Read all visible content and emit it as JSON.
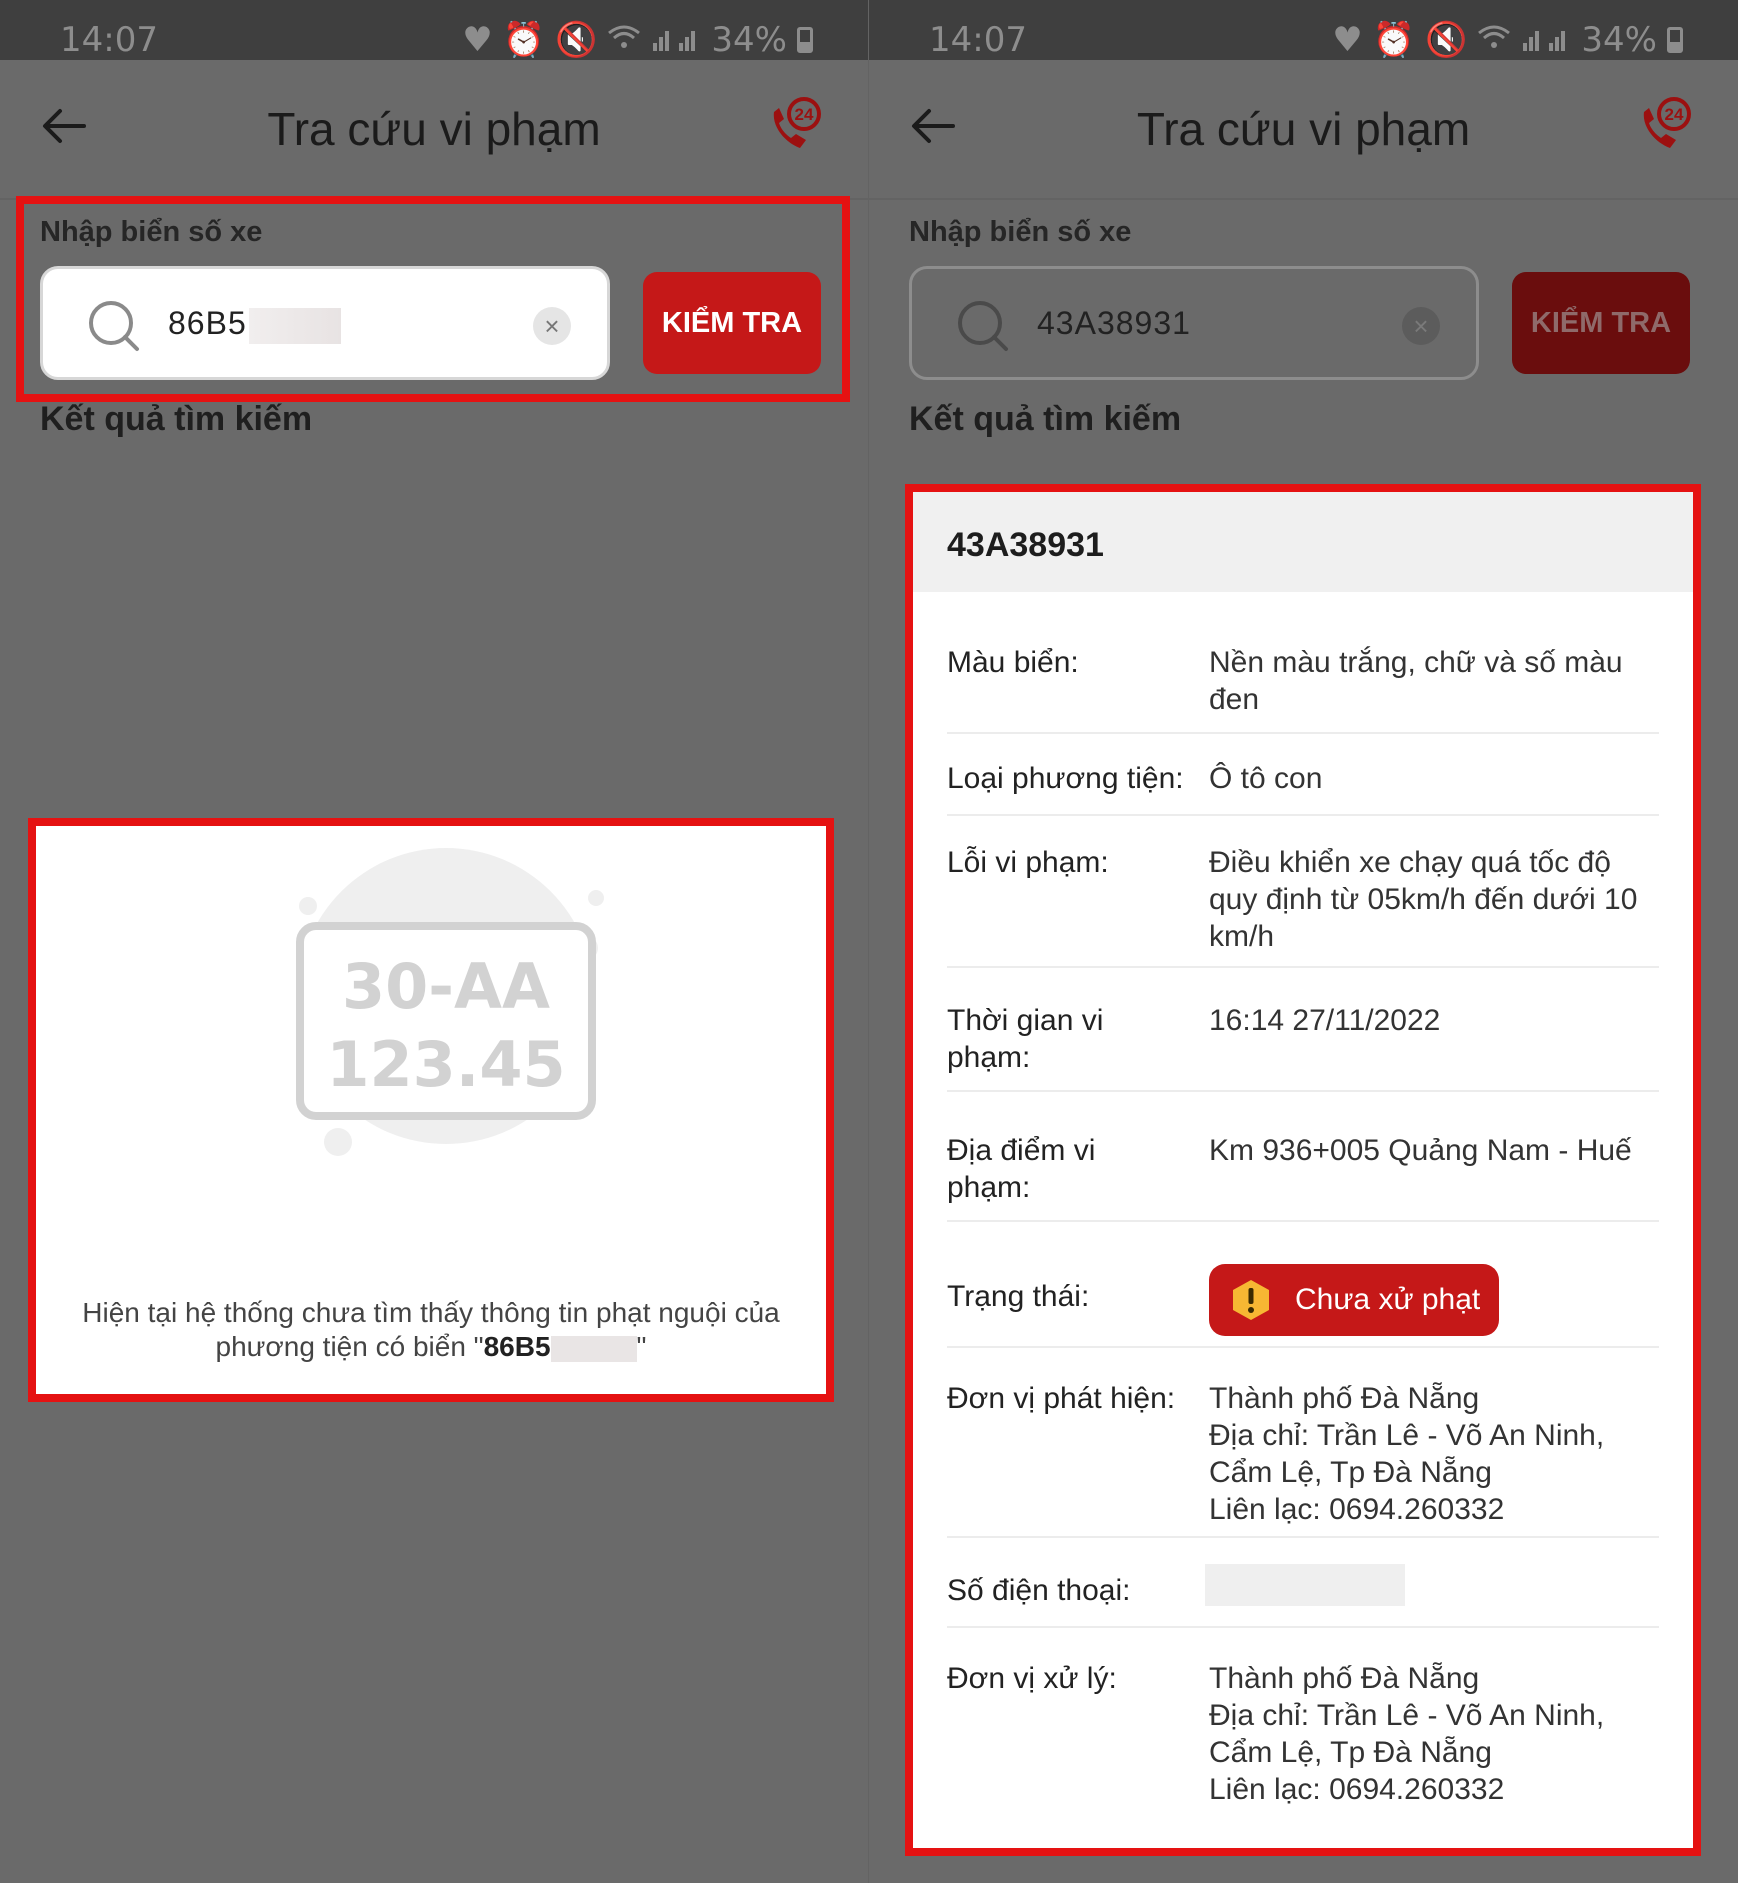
{
  "status_bar": {
    "time": "14:07",
    "battery": "34%"
  },
  "app": {
    "title": "Tra cứu vi phạm",
    "input_label": "Nhập biển số xe",
    "check_button": "KIỂM TRA",
    "results_title": "Kết quả tìm kiếm"
  },
  "icons": {
    "back": "arrow-left-icon",
    "hotline": "phone-24-icon",
    "search": "search-icon",
    "clear": "close-icon",
    "warning": "warning-icon"
  },
  "colors": {
    "accent": "#c51818",
    "highlight": "#e51212"
  },
  "left": {
    "input_value": "86B5",
    "illustration": {
      "line1": "30-AA",
      "line2": "123.45"
    },
    "empty_message_prefix": "Hiện tại hệ thống chưa tìm thấy thông tin phạt nguội của phương tiện có biển \"",
    "empty_message_plate": "86B5",
    "empty_message_suffix": "\""
  },
  "right": {
    "input_value": "43A38931",
    "plate": "43A38931",
    "rows": [
      {
        "key": "Màu biển:",
        "value": "Nền màu trắng, chữ và số màu đen"
      },
      {
        "key": "Loại phương tiện:",
        "value": "Ô tô con"
      },
      {
        "key": "Lỗi vi phạm:",
        "value": "Điều khiển xe chạy quá tốc độ quy định từ 05km/h đến dưới 10 km/h"
      },
      {
        "key": "Thời gian vi phạm:",
        "value": "16:14 27/11/2022"
      },
      {
        "key": "Địa điểm vi phạm:",
        "value": "Km 936+005 Quảng Nam - Huế"
      },
      {
        "key": "Trạng thái:",
        "value": "Chưa xử phạt"
      },
      {
        "key": "Đơn vị phát hiện:",
        "value": "Thành phố Đà Nẵng\nĐịa chỉ: Trần Lê - Võ An Ninh, Cẩm Lệ, Tp Đà Nẵng\nLiên lạc: 0694.260332"
      },
      {
        "key": "Số điện thoại:",
        "value": ""
      },
      {
        "key": "Đơn vị xử lý:",
        "value": "Thành phố Đà Nẵng\nĐịa chỉ: Trần Lê - Võ An Ninh, Cẩm Lệ, Tp Đà Nẵng\nLiên lạc: 0694.260332"
      }
    ]
  }
}
